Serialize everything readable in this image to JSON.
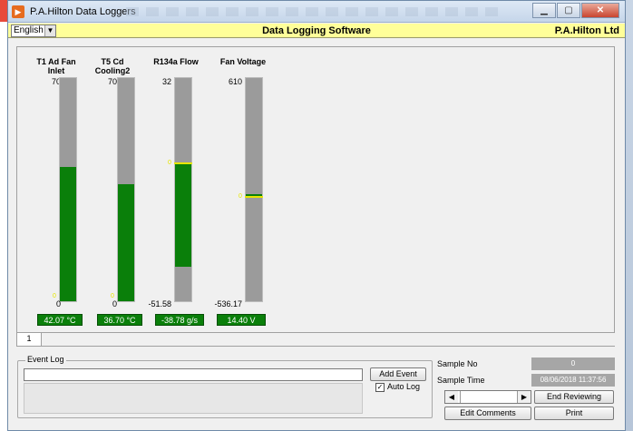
{
  "window": {
    "title": "P.A.Hilton Data Loggers",
    "icon": "app-logo-icon",
    "controls": [
      "minimize-icon",
      "maximize-icon",
      "close-icon"
    ]
  },
  "toolbar": {
    "language": "English",
    "app_title": "Data Logging Software",
    "company": "P.A.Hilton Ltd"
  },
  "gauges": [
    {
      "label_line1": "T1 Ad Fan",
      "label_line2": "Inlet",
      "max": "70",
      "min": "0",
      "value": "42.07 °C",
      "fill_bottom_frac": 0.0,
      "fill_top_frac": 0.601,
      "marker_frac": null,
      "tick_label": "0"
    },
    {
      "label_line1": "T5 Cd",
      "label_line2": "Cooling2",
      "max": "70",
      "min": "0",
      "value": "36.70 °C",
      "fill_bottom_frac": 0.0,
      "fill_top_frac": 0.524,
      "marker_frac": null,
      "tick_label": "0"
    },
    {
      "label_line1": "R134a Flow",
      "label_line2": "",
      "max": "32",
      "min": "-51.58",
      "value": "-38.78 g/s",
      "fill_bottom_frac": 0.153,
      "fill_top_frac": 0.617,
      "marker_frac": 0.617,
      "tick_label": "0"
    },
    {
      "label_line1": "Fan Voltage",
      "label_line2": "",
      "max": "610",
      "min": "-536.17",
      "value": "14.40 V",
      "fill_bottom_frac": 0.468,
      "fill_top_frac": 0.48,
      "marker_frac": 0.468,
      "tick_label": "0"
    }
  ],
  "tabs": [
    {
      "label": "1"
    }
  ],
  "event_log": {
    "legend": "Event Log",
    "input_value": "",
    "add_event_label": "Add Event",
    "auto_log_label": "Auto Log",
    "auto_log_checked": true
  },
  "sample": {
    "sample_no_label": "Sample No",
    "sample_no_value": "0",
    "sample_time_label": "Sample Time",
    "sample_time_value": "08/06/2018 11:37:56",
    "end_reviewing_label": "End Reviewing",
    "edit_comments_label": "Edit Comments",
    "print_label": "Print"
  },
  "colors": {
    "fill": "#0a7f0a",
    "bar": "#9b9b9b",
    "marker": "#e6e600",
    "toolbar_bg": "#ffff99"
  }
}
